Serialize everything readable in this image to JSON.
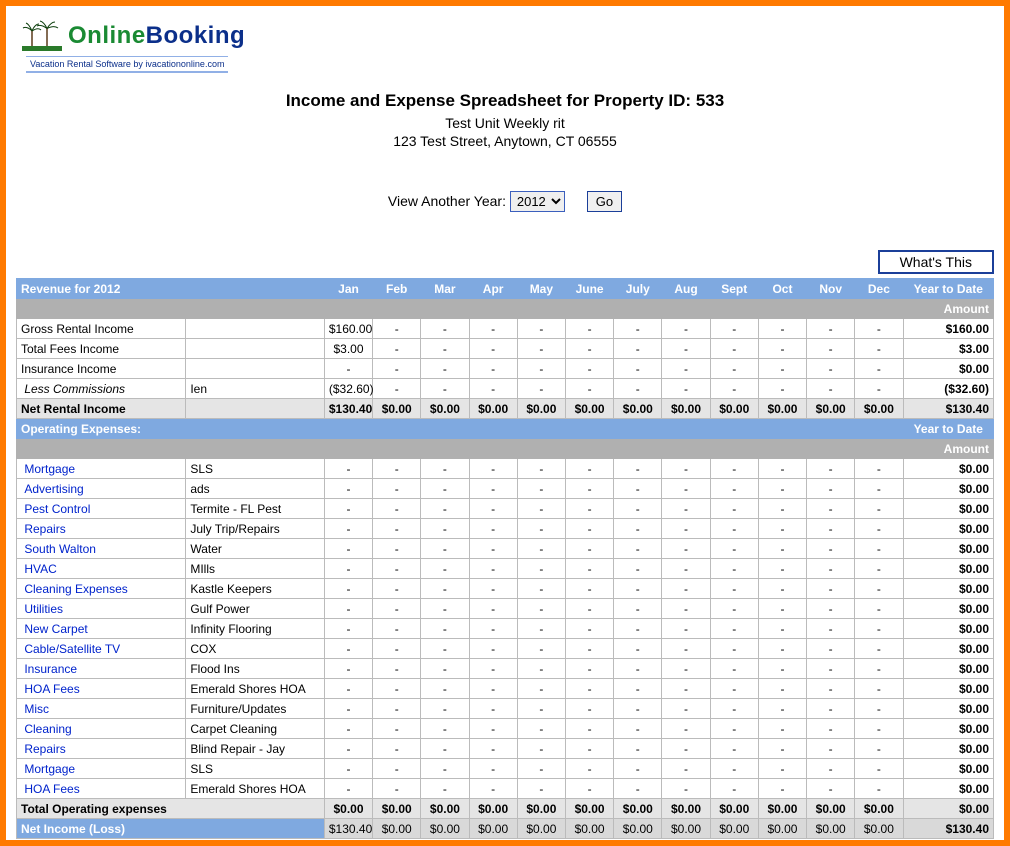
{
  "logo": {
    "text_a": "Online",
    "text_b": "Booking",
    "tagline": "Vacation Rental Software by ivacationonline.com"
  },
  "header": {
    "title": "Income and Expense Spreadsheet for Property ID: 533",
    "unit": "Test Unit Weekly rit",
    "address": "123 Test Street, Anytown, CT 06555"
  },
  "year_picker": {
    "label": "View Another Year:",
    "value": "2012",
    "go_label": "Go"
  },
  "whats_this": "What's This",
  "months": [
    "Jan",
    "Feb",
    "Mar",
    "Apr",
    "May",
    "June",
    "July",
    "Aug",
    "Sept",
    "Oct",
    "Nov",
    "Dec"
  ],
  "revenue_header": "Revenue for 2012",
  "ytd_label": "Year to Date",
  "amount_label": "Amount",
  "revenue_rows": [
    {
      "cat": "Gross Rental Income",
      "link": false,
      "italic": false,
      "desc": "",
      "vals": [
        "$160.00",
        "-",
        "-",
        "-",
        "-",
        "-",
        "-",
        "-",
        "-",
        "-",
        "-",
        "-"
      ],
      "ytd": "$160.00"
    },
    {
      "cat": "Total Fees Income",
      "link": false,
      "italic": false,
      "desc": "",
      "vals": [
        "$3.00",
        "-",
        "-",
        "-",
        "-",
        "-",
        "-",
        "-",
        "-",
        "-",
        "-",
        "-"
      ],
      "ytd": "$3.00"
    },
    {
      "cat": "Insurance Income",
      "link": false,
      "italic": false,
      "desc": "",
      "vals": [
        "-",
        "-",
        "-",
        "-",
        "-",
        "-",
        "-",
        "-",
        "-",
        "-",
        "-",
        "-"
      ],
      "ytd": "$0.00"
    },
    {
      "cat": "Less Commissions",
      "link": false,
      "italic": true,
      "desc": "Ien",
      "vals": [
        "($32.60)",
        "-",
        "-",
        "-",
        "-",
        "-",
        "-",
        "-",
        "-",
        "-",
        "-",
        "-"
      ],
      "ytd": "($32.60)"
    }
  ],
  "net_rental": {
    "cat": "Net Rental Income",
    "vals": [
      "$130.40",
      "$0.00",
      "$0.00",
      "$0.00",
      "$0.00",
      "$0.00",
      "$0.00",
      "$0.00",
      "$0.00",
      "$0.00",
      "$0.00",
      "$0.00"
    ],
    "ytd": "$130.40"
  },
  "expense_header": "Operating Expenses:",
  "expense_rows": [
    {
      "cat": "Mortgage",
      "desc": "SLS",
      "vals": [
        "-",
        "-",
        "-",
        "-",
        "-",
        "-",
        "-",
        "-",
        "-",
        "-",
        "-",
        "-"
      ],
      "ytd": "$0.00"
    },
    {
      "cat": "Advertising",
      "desc": "ads",
      "vals": [
        "-",
        "-",
        "-",
        "-",
        "-",
        "-",
        "-",
        "-",
        "-",
        "-",
        "-",
        "-"
      ],
      "ytd": "$0.00"
    },
    {
      "cat": "Pest Control",
      "desc": "Termite - FL Pest",
      "vals": [
        "-",
        "-",
        "-",
        "-",
        "-",
        "-",
        "-",
        "-",
        "-",
        "-",
        "-",
        "-"
      ],
      "ytd": "$0.00"
    },
    {
      "cat": "Repairs",
      "desc": "July Trip/Repairs",
      "vals": [
        "-",
        "-",
        "-",
        "-",
        "-",
        "-",
        "-",
        "-",
        "-",
        "-",
        "-",
        "-"
      ],
      "ytd": "$0.00"
    },
    {
      "cat": "South Walton",
      "desc": "Water",
      "vals": [
        "-",
        "-",
        "-",
        "-",
        "-",
        "-",
        "-",
        "-",
        "-",
        "-",
        "-",
        "-"
      ],
      "ytd": "$0.00"
    },
    {
      "cat": "HVAC",
      "desc": "MIlls",
      "vals": [
        "-",
        "-",
        "-",
        "-",
        "-",
        "-",
        "-",
        "-",
        "-",
        "-",
        "-",
        "-"
      ],
      "ytd": "$0.00"
    },
    {
      "cat": "Cleaning Expenses",
      "desc": "Kastle Keepers",
      "vals": [
        "-",
        "-",
        "-",
        "-",
        "-",
        "-",
        "-",
        "-",
        "-",
        "-",
        "-",
        "-"
      ],
      "ytd": "$0.00"
    },
    {
      "cat": "Utilities",
      "desc": "Gulf Power",
      "vals": [
        "-",
        "-",
        "-",
        "-",
        "-",
        "-",
        "-",
        "-",
        "-",
        "-",
        "-",
        "-"
      ],
      "ytd": "$0.00"
    },
    {
      "cat": "New Carpet",
      "desc": "Infinity Flooring",
      "vals": [
        "-",
        "-",
        "-",
        "-",
        "-",
        "-",
        "-",
        "-",
        "-",
        "-",
        "-",
        "-"
      ],
      "ytd": "$0.00"
    },
    {
      "cat": "Cable/Satellite TV",
      "desc": "COX",
      "vals": [
        "-",
        "-",
        "-",
        "-",
        "-",
        "-",
        "-",
        "-",
        "-",
        "-",
        "-",
        "-"
      ],
      "ytd": "$0.00"
    },
    {
      "cat": "Insurance",
      "desc": "Flood Ins",
      "vals": [
        "-",
        "-",
        "-",
        "-",
        "-",
        "-",
        "-",
        "-",
        "-",
        "-",
        "-",
        "-"
      ],
      "ytd": "$0.00"
    },
    {
      "cat": "HOA Fees",
      "desc": "Emerald Shores HOA",
      "vals": [
        "-",
        "-",
        "-",
        "-",
        "-",
        "-",
        "-",
        "-",
        "-",
        "-",
        "-",
        "-"
      ],
      "ytd": "$0.00"
    },
    {
      "cat": "Misc",
      "desc": "Furniture/Updates",
      "vals": [
        "-",
        "-",
        "-",
        "-",
        "-",
        "-",
        "-",
        "-",
        "-",
        "-",
        "-",
        "-"
      ],
      "ytd": "$0.00"
    },
    {
      "cat": "Cleaning",
      "desc": "Carpet Cleaning",
      "vals": [
        "-",
        "-",
        "-",
        "-",
        "-",
        "-",
        "-",
        "-",
        "-",
        "-",
        "-",
        "-"
      ],
      "ytd": "$0.00"
    },
    {
      "cat": "Repairs",
      "desc": "Blind Repair - Jay",
      "vals": [
        "-",
        "-",
        "-",
        "-",
        "-",
        "-",
        "-",
        "-",
        "-",
        "-",
        "-",
        "-"
      ],
      "ytd": "$0.00"
    },
    {
      "cat": "Mortgage",
      "desc": "SLS",
      "vals": [
        "-",
        "-",
        "-",
        "-",
        "-",
        "-",
        "-",
        "-",
        "-",
        "-",
        "-",
        "-"
      ],
      "ytd": "$0.00"
    },
    {
      "cat": "HOA Fees",
      "desc": "Emerald Shores HOA",
      "vals": [
        "-",
        "-",
        "-",
        "-",
        "-",
        "-",
        "-",
        "-",
        "-",
        "-",
        "-",
        "-"
      ],
      "ytd": "$0.00"
    }
  ],
  "total_expenses": {
    "cat": "Total Operating expenses",
    "vals": [
      "$0.00",
      "$0.00",
      "$0.00",
      "$0.00",
      "$0.00",
      "$0.00",
      "$0.00",
      "$0.00",
      "$0.00",
      "$0.00",
      "$0.00",
      "$0.00"
    ],
    "ytd": "$0.00"
  },
  "net_income": {
    "cat": "Net Income (Loss)",
    "vals": [
      "$130.40",
      "$0.00",
      "$0.00",
      "$0.00",
      "$0.00",
      "$0.00",
      "$0.00",
      "$0.00",
      "$0.00",
      "$0.00",
      "$0.00",
      "$0.00"
    ],
    "ytd": "$130.40"
  }
}
